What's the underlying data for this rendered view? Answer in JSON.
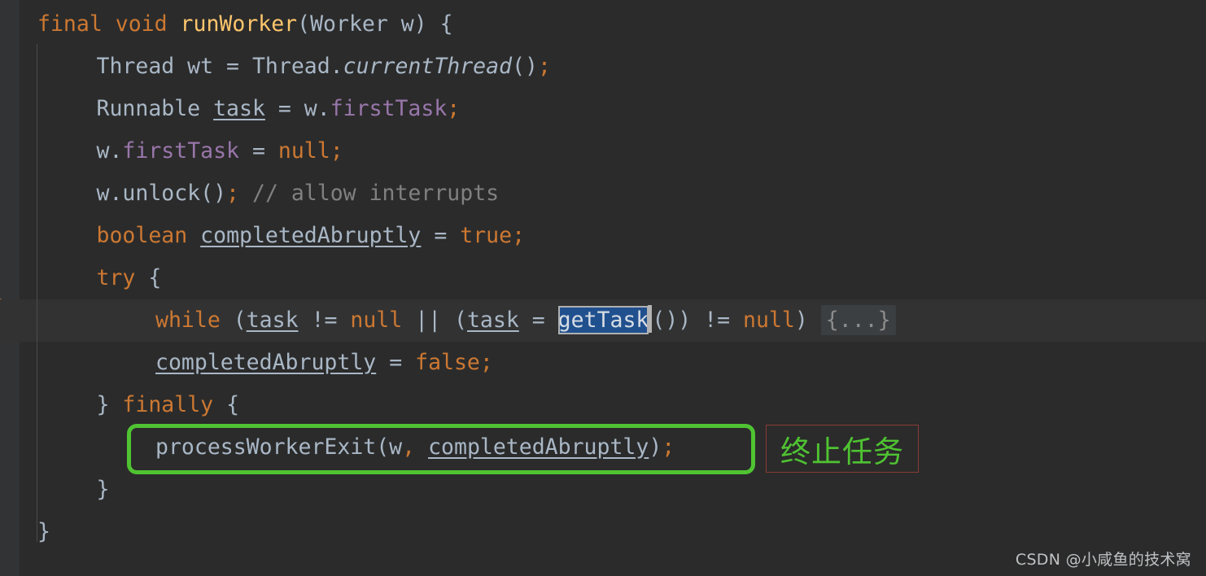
{
  "editor": {
    "theme_name": "darcula",
    "background": "#2B2B2B",
    "gutter_background": "#313335",
    "current_line_background": "#323232",
    "default_text_color": "#A9B7C6",
    "keyword_color": "#CC7832",
    "method_color": "#FFC66D",
    "field_color": "#9876AA",
    "comment_color": "#808080",
    "selection_background": "#21508E",
    "fold_background": "#3C3F41",
    "language": "java"
  },
  "gutter": {
    "intention_bulb_icon": "lightbulb-icon",
    "intention_bulb_color": "#EDA549"
  },
  "code": {
    "lines": [
      {
        "index": 0,
        "indent": 0,
        "tokens": [
          {
            "t": "final",
            "c": "kw"
          },
          {
            "t": " ",
            "c": "plain"
          },
          {
            "t": "void",
            "c": "kw"
          },
          {
            "t": " ",
            "c": "plain"
          },
          {
            "t": "runWorker",
            "c": "fn"
          },
          {
            "t": "(Worker w) {",
            "c": "plain"
          }
        ]
      },
      {
        "index": 1,
        "indent": 1,
        "tokens": [
          {
            "t": "Thread wt = Thread.",
            "c": "plain"
          },
          {
            "t": "currentThread",
            "c": "stat"
          },
          {
            "t": "()",
            "c": "plain"
          },
          {
            "t": ";",
            "c": "semi"
          }
        ]
      },
      {
        "index": 2,
        "indent": 1,
        "tokens": [
          {
            "t": "Runnable ",
            "c": "plain"
          },
          {
            "t": "task",
            "c": "under"
          },
          {
            "t": " = w.",
            "c": "plain"
          },
          {
            "t": "firstTask",
            "c": "field"
          },
          {
            "t": ";",
            "c": "semi"
          }
        ]
      },
      {
        "index": 3,
        "indent": 1,
        "tokens": [
          {
            "t": "w.",
            "c": "plain"
          },
          {
            "t": "firstTask",
            "c": "field"
          },
          {
            "t": " = ",
            "c": "plain"
          },
          {
            "t": "null",
            "c": "kw"
          },
          {
            "t": ";",
            "c": "semi"
          }
        ]
      },
      {
        "index": 4,
        "indent": 1,
        "tokens": [
          {
            "t": "w.unlock()",
            "c": "plain"
          },
          {
            "t": ";",
            "c": "semi"
          },
          {
            "t": " ",
            "c": "plain"
          },
          {
            "t": "// allow interrupts",
            "c": "cmt"
          }
        ]
      },
      {
        "index": 5,
        "indent": 1,
        "tokens": [
          {
            "t": "boolean",
            "c": "kw"
          },
          {
            "t": " ",
            "c": "plain"
          },
          {
            "t": "completedAbruptly",
            "c": "under"
          },
          {
            "t": " = ",
            "c": "plain"
          },
          {
            "t": "true",
            "c": "kw"
          },
          {
            "t": ";",
            "c": "semi"
          }
        ]
      },
      {
        "index": 6,
        "indent": 1,
        "tokens": [
          {
            "t": "try",
            "c": "kw"
          },
          {
            "t": " {",
            "c": "plain"
          }
        ]
      },
      {
        "index": 7,
        "indent": 2,
        "current_line": true,
        "tokens": [
          {
            "t": "while",
            "c": "kw"
          },
          {
            "t": " (",
            "c": "plain"
          },
          {
            "t": "task",
            "c": "under"
          },
          {
            "t": " != ",
            "c": "plain"
          },
          {
            "t": "null",
            "c": "kw"
          },
          {
            "t": " || (",
            "c": "plain"
          },
          {
            "t": "task",
            "c": "under"
          },
          {
            "t": " = ",
            "c": "plain"
          },
          {
            "t": "getTask",
            "c": "sel"
          },
          {
            "t": "()) != ",
            "c": "plain"
          },
          {
            "t": "null",
            "c": "kw"
          },
          {
            "t": ") ",
            "c": "plain"
          },
          {
            "t": "{...}",
            "c": "fold"
          }
        ]
      },
      {
        "index": 8,
        "indent": 2,
        "tokens": [
          {
            "t": "completedAbruptly",
            "c": "under"
          },
          {
            "t": " = ",
            "c": "plain"
          },
          {
            "t": "false",
            "c": "kw"
          },
          {
            "t": ";",
            "c": "semi"
          }
        ]
      },
      {
        "index": 9,
        "indent": 1,
        "tokens": [
          {
            "t": "} ",
            "c": "plain"
          },
          {
            "t": "finally",
            "c": "kw"
          },
          {
            "t": " {",
            "c": "plain"
          }
        ]
      },
      {
        "index": 10,
        "indent": 2,
        "tokens": [
          {
            "t": "processWorkerExit(w",
            "c": "plain"
          },
          {
            "t": ",",
            "c": "semi"
          },
          {
            "t": " ",
            "c": "plain"
          },
          {
            "t": "completedAbruptly",
            "c": "under"
          },
          {
            "t": ")",
            "c": "plain"
          },
          {
            "t": ";",
            "c": "semi"
          }
        ]
      },
      {
        "index": 11,
        "indent": 1,
        "tokens": [
          {
            "t": "}",
            "c": "plain"
          }
        ]
      },
      {
        "index": 12,
        "indent": 0,
        "tokens": [
          {
            "t": "}",
            "c": "plain"
          }
        ]
      }
    ]
  },
  "annotations": {
    "highlight_box": {
      "label": "green-highlight-rect",
      "color": "#4FC332",
      "targets_line_index": 10
    },
    "note": {
      "text": "终止任务",
      "text_color": "#4FC332",
      "border_color": "#8A3B35"
    }
  },
  "watermark": {
    "text": "CSDN @小咸鱼的技术窝"
  }
}
